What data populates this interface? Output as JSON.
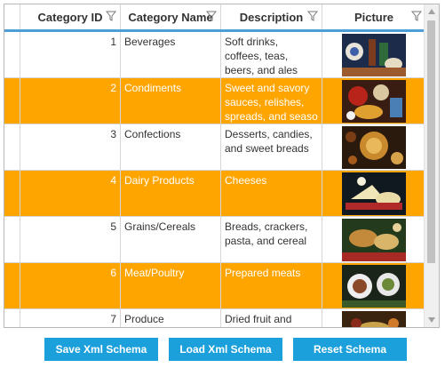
{
  "grid": {
    "columns": [
      {
        "label": "Category ID"
      },
      {
        "label": "Category Name"
      },
      {
        "label": "Description"
      },
      {
        "label": "Picture"
      }
    ],
    "rows": [
      {
        "id": "1",
        "name": "Beverages",
        "description": "Soft drinks, coffees, teas, beers, and ales"
      },
      {
        "id": "2",
        "name": "Condiments",
        "description": "Sweet and savory sauces, relishes, spreads, and seaso"
      },
      {
        "id": "3",
        "name": "Confections",
        "description": "Desserts, candies, and sweet breads"
      },
      {
        "id": "4",
        "name": "Dairy Products",
        "description": "Cheeses"
      },
      {
        "id": "5",
        "name": "Grains/Cereals",
        "description": "Breads, crackers, pasta, and cereal"
      },
      {
        "id": "6",
        "name": "Meat/Poultry",
        "description": "Prepared meats"
      },
      {
        "id": "7",
        "name": "Produce",
        "description": "Dried fruit and"
      }
    ],
    "alt_row_color": "#ffa500",
    "header_accent": "#4b9fd6"
  },
  "buttons": {
    "save": "Save Xml Schema",
    "load": "Load Xml Schema",
    "reset": "Reset Schema",
    "color": "#1ca0db"
  },
  "icons": {
    "filter": "filter-icon",
    "scroll_up": "chevron-up-icon",
    "scroll_down": "chevron-down-icon"
  }
}
